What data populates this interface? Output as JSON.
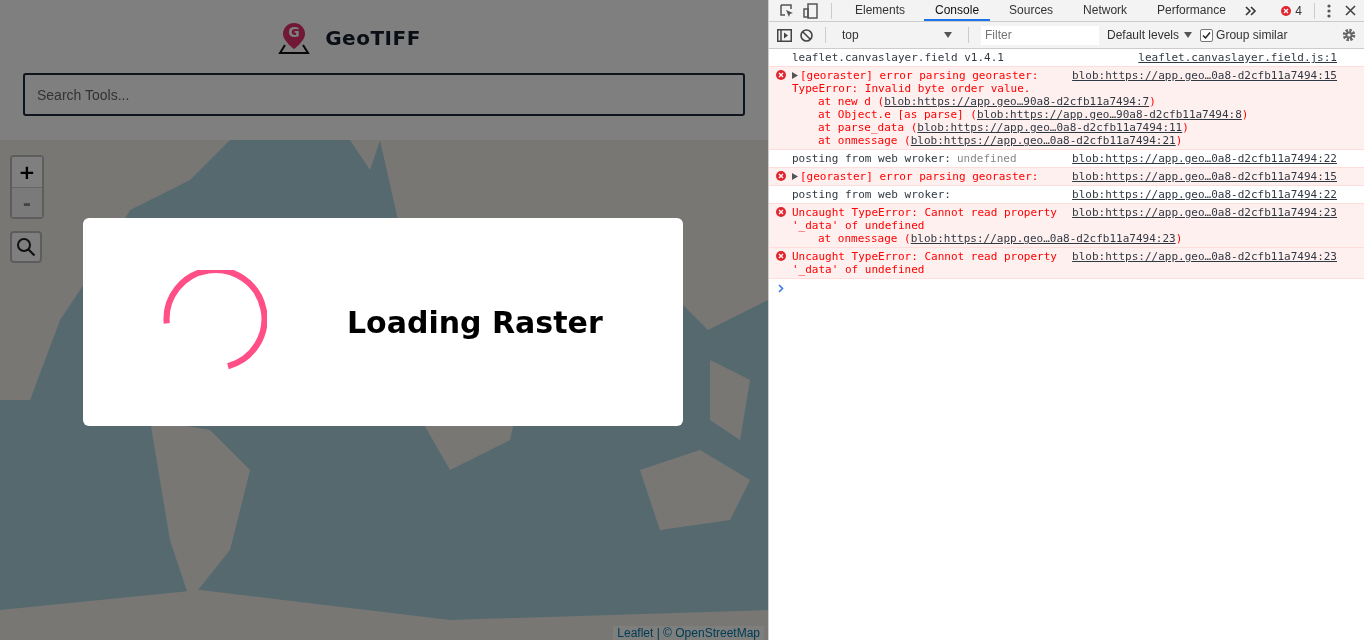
{
  "app": {
    "logo_mark": "G",
    "title": "GeoTIFF",
    "search": {
      "placeholder": "Search Tools..."
    },
    "zoom_controls": [
      {
        "label": "+",
        "disabled": false
      },
      {
        "label": "-",
        "disabled": true
      }
    ],
    "attribution": "Leaflet | © OpenStreetMap",
    "loading": {
      "text": "Loading Raster"
    }
  },
  "devtools": {
    "tabs": [
      {
        "label": "Elements",
        "selected": false
      },
      {
        "label": "Console",
        "selected": true
      },
      {
        "label": "Sources",
        "selected": false
      },
      {
        "label": "Network",
        "selected": false
      },
      {
        "label": "Performance",
        "selected": false
      }
    ],
    "error_count": "4",
    "console_toolbar": {
      "context": "top",
      "filter": {
        "placeholder": "Filter"
      },
      "levels": "Default levels",
      "group_similar": {
        "label": "Group similar",
        "checked": true
      }
    },
    "messages": [
      {
        "kind": "log",
        "text": "leaflet.canvaslayer.field v1.4.1",
        "source": "leaflet.canvaslayer.field.js:1"
      },
      {
        "kind": "error",
        "expandable": true,
        "text": "[georaster] error parsing georaster:",
        "source": "blob:https://app.geo…0a8-d2cfb11a7494:15",
        "detail": "TypeError: Invalid byte order value.",
        "stack": [
          {
            "call": "at new d (",
            "link": "blob:https://app.geo…90a8-d2cfb11a7494:7",
            "close": ")"
          },
          {
            "call": "at Object.e [as parse] (",
            "link": "blob:https://app.geo…90a8-d2cfb11a7494:8",
            "close": ")"
          },
          {
            "call": "at parse_data (",
            "link": "blob:https://app.geo…0a8-d2cfb11a7494:11",
            "close": ")"
          },
          {
            "call": "at onmessage (",
            "link": "blob:https://app.geo…0a8-d2cfb11a7494:21",
            "close": ")"
          }
        ]
      },
      {
        "kind": "log",
        "text": "posting from web wroker:",
        "value": "undefined",
        "source": "blob:https://app.geo…0a8-d2cfb11a7494:22"
      },
      {
        "kind": "error",
        "expandable": true,
        "text": "[georaster] error parsing georaster:",
        "source": "blob:https://app.geo…0a8-d2cfb11a7494:15"
      },
      {
        "kind": "log",
        "text": "posting from web wroker:",
        "source": "blob:https://app.geo…0a8-d2cfb11a7494:22"
      },
      {
        "kind": "error",
        "expandable": false,
        "text": "Uncaught TypeError: Cannot read property '_data' of undefined",
        "source": "blob:https://app.geo…0a8-d2cfb11a7494:23",
        "stack": [
          {
            "call": "at onmessage (",
            "link": "blob:https://app.geo…0a8-d2cfb11a7494:23",
            "close": ")"
          }
        ]
      },
      {
        "kind": "error",
        "expandable": false,
        "text": "Uncaught TypeError: Cannot read property '_data' of undefined",
        "source": "blob:https://app.geo…0a8-d2cfb11a7494:23"
      }
    ]
  }
}
